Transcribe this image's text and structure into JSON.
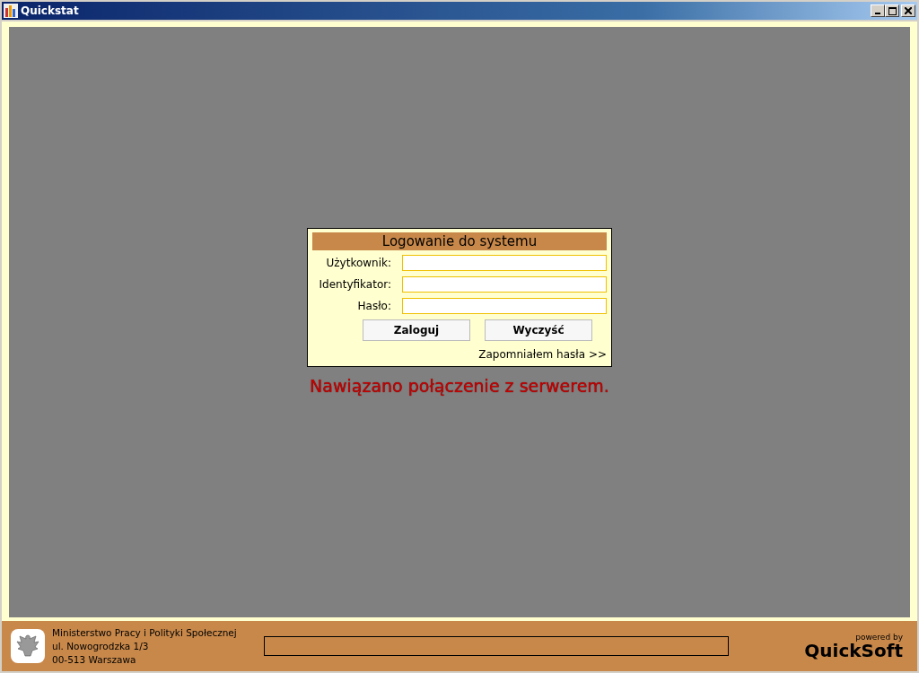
{
  "window": {
    "title": "Quickstat"
  },
  "login": {
    "title": "Logowanie do systemu",
    "fields": [
      {
        "label": "Użytkownik:"
      },
      {
        "label": "Identyfikator:"
      },
      {
        "label": "Hasło:"
      }
    ],
    "buttons": [
      "Zaloguj",
      "Wyczyść"
    ],
    "forgot_link": "Zapomniałem hasła >>"
  },
  "status_message": "Nawiązano połączenie z serwerem.",
  "footer": {
    "address": [
      "Ministerstwo Pracy i Polityki Społecznej",
      "ul. Nowogrodzka 1/3",
      "00-513 Warszawa"
    ],
    "progress": {
      "level": 0
    },
    "powered_by": "powered by",
    "brand": "QuickSoft"
  }
}
